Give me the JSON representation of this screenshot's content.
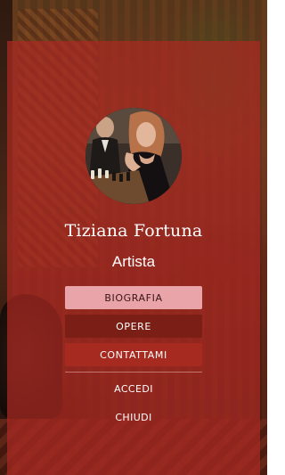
{
  "profile": {
    "name": "Tiziana Fortuna",
    "role": "Artista"
  },
  "menu": {
    "biografia": "BIOGRAFIA",
    "opere": "OPERE",
    "contattami": "CONTATTAMI",
    "accedi": "ACCEDI",
    "chiudi": "CHIUDI"
  },
  "colors": {
    "panel": "#ab2a22",
    "active_button": "#e8a4a8",
    "dark_button": "#7a1e16",
    "contact_button": "#a72a20",
    "text": "#ffffff"
  },
  "icons": {
    "avatar": "profile-photo"
  }
}
